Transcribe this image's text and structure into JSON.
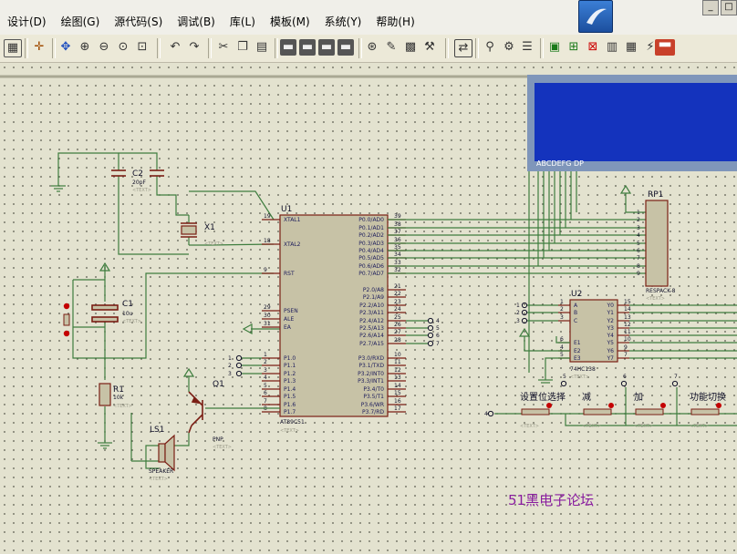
{
  "menu": {
    "items": [
      "设计(D)",
      "绘图(G)",
      "源代码(S)",
      "调试(B)",
      "库(L)",
      "模板(M)",
      "系统(Y)",
      "帮助(H)"
    ]
  },
  "window": {
    "controls": [
      "_",
      "□"
    ]
  },
  "toolbar": {
    "icons": [
      "grid-toggle-icon",
      "origin-icon",
      "pan-icon",
      "zoom-in-icon",
      "zoom-out-icon",
      "zoom-all-icon",
      "zoom-area-icon",
      "undo-icon",
      "redo-icon",
      "cut-icon",
      "copy-icon",
      "paste-icon",
      "block-copy-icon",
      "block-move-icon",
      "block-rotate-icon",
      "block-delete-icon",
      "pick-device-icon",
      "make-device-icon",
      "packaging-icon",
      "decompose-icon",
      "wire-autorouter-icon",
      "search-icon",
      "property-assignment-icon",
      "design-explorer-icon",
      "new-sheet-icon",
      "remove-sheet-icon",
      "goto-sheet-icon",
      "bill-of-materials-icon",
      "electrical-rules-icon",
      "netlist-to-ares-icon"
    ]
  },
  "lcd": {
    "segment_labels": "ABCDEFG  DP"
  },
  "components": {
    "u1": {
      "ref": "U1",
      "part": "AT89C51",
      "text": "<TEXT>"
    },
    "c2": {
      "ref": "C2",
      "value": "20pF",
      "text": "<TEXT>"
    },
    "x1": {
      "ref": "X1",
      "text": "<TEXT>"
    },
    "c1": {
      "ref": "C1",
      "value": "10u",
      "text": "<TEXT>"
    },
    "r1": {
      "ref": "R1",
      "value": "10k",
      "text": "<TEXT>"
    },
    "q1": {
      "ref": "Q1",
      "type": "PNP",
      "text": "<TEXT>"
    },
    "ls1": {
      "ref": "LS1",
      "type": "SPEAKER",
      "text": "<TEXT>"
    },
    "rp1": {
      "ref": "RP1",
      "type": "RESPACK-8",
      "text": "<TEXT>"
    },
    "u2": {
      "ref": "U2",
      "part": "74HC138",
      "text": "<TEXT>"
    }
  },
  "u1_pins_left": [
    {
      "num": "19",
      "name": "XTAL1"
    },
    {
      "num": "18",
      "name": "XTAL2"
    },
    {
      "num": "9",
      "name": "RST"
    },
    {
      "num": "29",
      "name": "PSEN"
    },
    {
      "num": "30",
      "name": "ALE"
    },
    {
      "num": "31",
      "name": "EA"
    },
    {
      "num": "1",
      "name": "P1.0"
    },
    {
      "num": "2",
      "name": "P1.1"
    },
    {
      "num": "3",
      "name": "P1.2"
    },
    {
      "num": "4",
      "name": "P1.3"
    },
    {
      "num": "5",
      "name": "P1.4"
    },
    {
      "num": "6",
      "name": "P1.5"
    },
    {
      "num": "7",
      "name": "P1.6"
    },
    {
      "num": "8",
      "name": "P1.7"
    }
  ],
  "u1_pins_right": [
    {
      "num": "39",
      "name": "P0.0/AD0"
    },
    {
      "num": "38",
      "name": "P0.1/AD1"
    },
    {
      "num": "37",
      "name": "P0.2/AD2"
    },
    {
      "num": "36",
      "name": "P0.3/AD3"
    },
    {
      "num": "35",
      "name": "P0.4/AD4"
    },
    {
      "num": "34",
      "name": "P0.5/AD5"
    },
    {
      "num": "33",
      "name": "P0.6/AD6"
    },
    {
      "num": "32",
      "name": "P0.7/AD7"
    },
    {
      "num": "21",
      "name": "P2.0/A8"
    },
    {
      "num": "22",
      "name": "P2.1/A9"
    },
    {
      "num": "23",
      "name": "P2.2/A10"
    },
    {
      "num": "24",
      "name": "P2.3/A11"
    },
    {
      "num": "25",
      "name": "P2.4/A12"
    },
    {
      "num": "26",
      "name": "P2.5/A13"
    },
    {
      "num": "27",
      "name": "P2.6/A14"
    },
    {
      "num": "28",
      "name": "P2.7/A15"
    },
    {
      "num": "10",
      "name": "P3.0/RXD"
    },
    {
      "num": "11",
      "name": "P3.1/TXD"
    },
    {
      "num": "12",
      "name": "P3.2/INT0"
    },
    {
      "num": "13",
      "name": "P3.3/INT1"
    },
    {
      "num": "14",
      "name": "P3.4/T0"
    },
    {
      "num": "15",
      "name": "P3.5/T1"
    },
    {
      "num": "16",
      "name": "P3.6/WR"
    },
    {
      "num": "17",
      "name": "P3.7/RD"
    }
  ],
  "u1_p2_terminals": [
    "4",
    "5",
    "6",
    "7"
  ],
  "u1_p1_terminals": [
    "1",
    "2",
    "3"
  ],
  "rp1_pins": [
    "1",
    "2",
    "3",
    "4",
    "5",
    "6",
    "7",
    "8",
    "9"
  ],
  "u2_pins_left": [
    {
      "num": "1",
      "name": "A",
      "terminal": "1"
    },
    {
      "num": "2",
      "name": "B",
      "terminal": "2"
    },
    {
      "num": "3",
      "name": "C",
      "terminal": "3"
    },
    {
      "num": "6",
      "name": "E1",
      "terminal": "5"
    },
    {
      "num": "4",
      "name": "E2",
      "terminal": "4"
    },
    {
      "num": "5",
      "name": "E3",
      "terminal": ""
    }
  ],
  "u2_pins_right": [
    {
      "num": "15",
      "name": "Y0"
    },
    {
      "num": "14",
      "name": "Y1"
    },
    {
      "num": "13",
      "name": "Y2"
    },
    {
      "num": "12",
      "name": "Y3"
    },
    {
      "num": "11",
      "name": "Y4"
    },
    {
      "num": "10",
      "name": "Y5"
    },
    {
      "num": "9",
      "name": "Y6"
    },
    {
      "num": "7",
      "name": "Y7"
    }
  ],
  "buttons": [
    {
      "label": "设置位选择",
      "terminal": "4"
    },
    {
      "label": "减",
      "terminal": "5"
    },
    {
      "label": "加",
      "terminal": "6"
    },
    {
      "label": "功能切换",
      "terminal": "7"
    }
  ],
  "watermark": "51黑电子论坛",
  "colors": {
    "wire": "#3e7d3e",
    "component": "#7a1e14",
    "chip_fill": "#c7c2a6",
    "text_dark": "#101028",
    "pin_label": "#1c1c5c",
    "lcd_fill": "#1433bd",
    "lcd_border": "#7f96ba",
    "watermark": "#8a1da0",
    "terminal_red": "#c40000"
  }
}
